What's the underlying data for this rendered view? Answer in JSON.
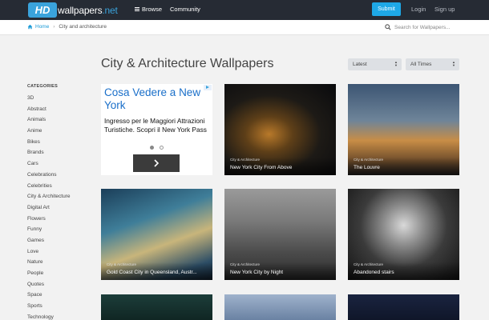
{
  "header": {
    "logo_mark": "HD",
    "logo_text": "wallpapers",
    "logo_suffix": ".net",
    "nav_browse": "Browse",
    "nav_community": "Community",
    "submit_label": "Submit",
    "login_label": "Login",
    "signup_label": "Sign up"
  },
  "breadcrumb": {
    "home": "Home",
    "current": "City and architecture"
  },
  "search": {
    "placeholder": "Search for Wallpapers..."
  },
  "page": {
    "title": "City & Architecture Wallpapers",
    "sort_selected": "Latest",
    "time_selected": "All Times"
  },
  "sidebar": {
    "title": "CATEGORIES",
    "items": [
      "3D",
      "Abstract",
      "Animals",
      "Anime",
      "Bikes",
      "Brands",
      "Cars",
      "Celebrations",
      "Celebrities",
      "City & Architecture",
      "Digital Art",
      "Flowers",
      "Funny",
      "Games",
      "Love",
      "Nature",
      "People",
      "Quotes",
      "Space",
      "Sports",
      "Technology"
    ]
  },
  "ad": {
    "headline": "Cosa Vedere a New York",
    "body": "Ingresso per le Maggiori Attrazioni Turistiche. Scopri il New York Pass"
  },
  "wallpapers": [
    {
      "category": "City & Architecture",
      "title": "New York City From Above"
    },
    {
      "category": "City & Architecture",
      "title": "The Louvre"
    },
    {
      "category": "City & Architecture",
      "title": "Gold Coast City in Queensland, Austr..."
    },
    {
      "category": "City & Architecture",
      "title": "New York City by Night"
    },
    {
      "category": "City & Architecture",
      "title": "Abandoned stairs"
    }
  ],
  "colors": {
    "header_bg": "#262b34",
    "accent": "#1ea8e6",
    "link": "#1a9ad6"
  }
}
